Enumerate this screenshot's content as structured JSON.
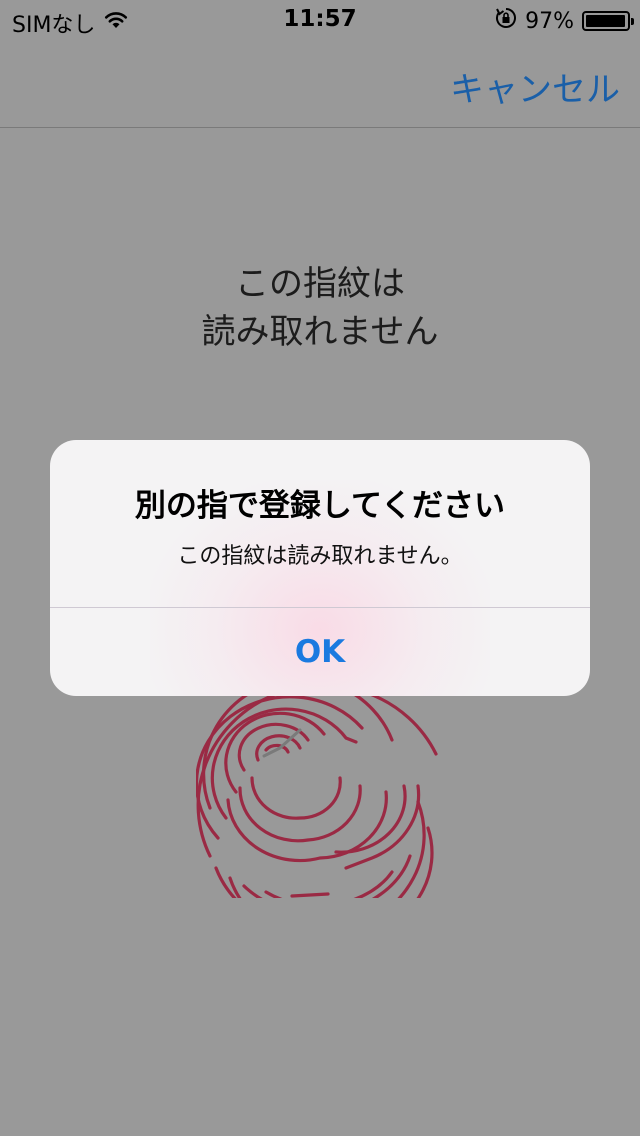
{
  "status_bar": {
    "carrier": "SIMなし",
    "time": "11:57",
    "battery_percent": "97%",
    "battery_level": 0.97,
    "icons": [
      "wifi-icon",
      "rotation-lock-icon",
      "battery-icon"
    ]
  },
  "nav": {
    "cancel_label": "キャンセル"
  },
  "instruction": {
    "line1": "この指紋は",
    "line2": "読み取れません"
  },
  "alert": {
    "title": "別の指で登録してください",
    "message": "この指紋は読み取れません。",
    "ok_label": "OK"
  },
  "colors": {
    "background": "#999999",
    "accent": "#1a7ae0",
    "fingerprint": "#9a2a44"
  }
}
